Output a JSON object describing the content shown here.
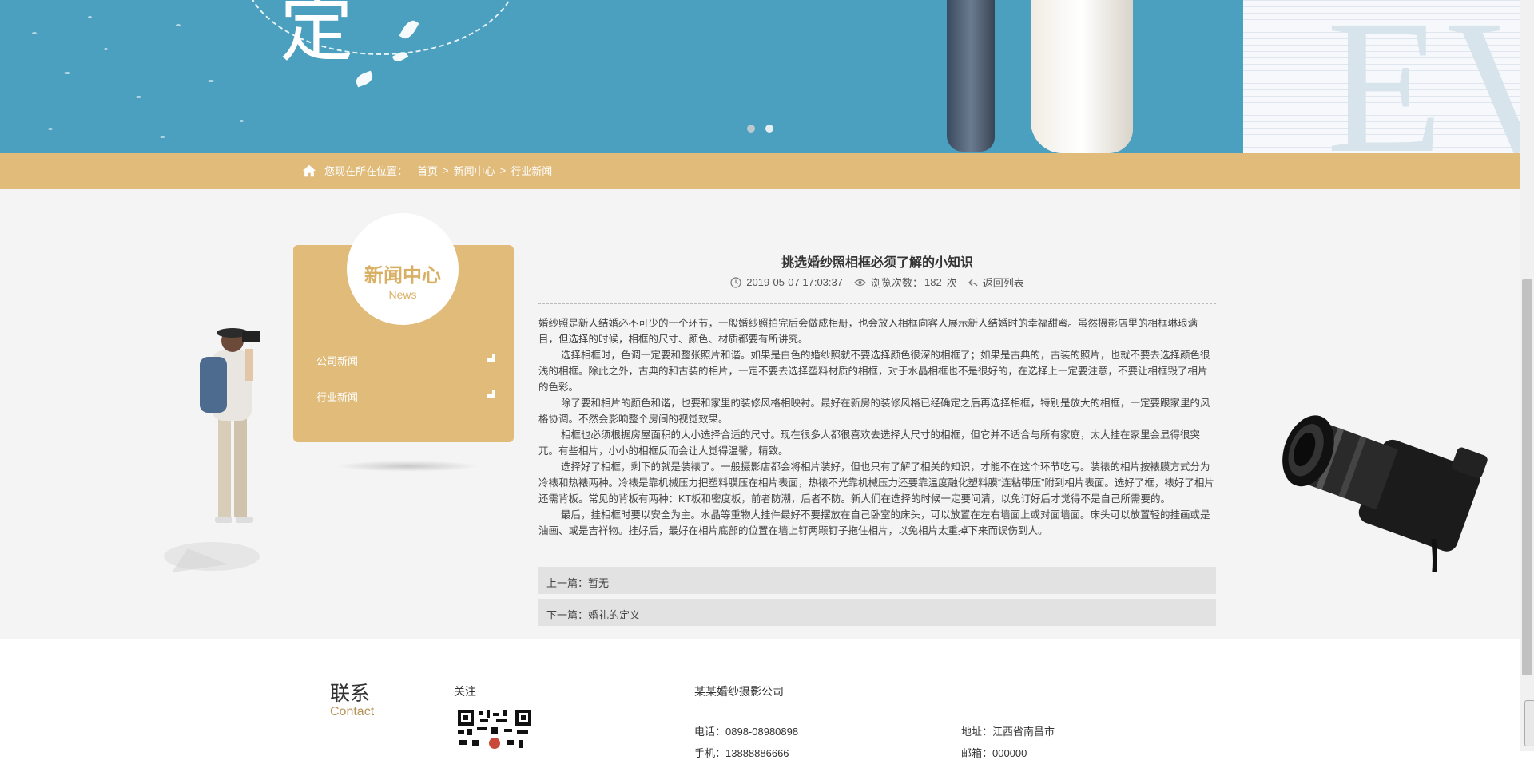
{
  "breadcrumb": {
    "prefix": "您现在所在位置：",
    "items": [
      "首页",
      "新闻中心",
      "行业新闻"
    ],
    "separator": ">"
  },
  "sidebar": {
    "title": "新闻中心",
    "subtitle": "News",
    "items": [
      {
        "label": "公司新闻"
      },
      {
        "label": "行业新闻"
      }
    ]
  },
  "article": {
    "title": "挑选婚纱照相框必须了解的小知识",
    "date": "2019-05-07 17:03:37",
    "views_label": "浏览次数：",
    "views": "182",
    "views_unit": "次",
    "back_label": "返回列表",
    "paragraphs": [
      "婚纱照是新人结婚必不可少的一个环节，一般婚纱照拍完后会做成相册，也会放入相框向客人展示新人结婚时的幸福甜蜜。虽然摄影店里的相框琳琅满目，但选择的时候，相框的尺寸、颜色、材质都要有所讲究。",
      "选择相框时，色调一定要和整张照片和谐。如果是白色的婚纱照就不要选择颜色很深的相框了；如果是古典的，古装的照片，也就不要去选择颜色很浅的相框。除此之外，古典的和古装的相片，一定不要去选择塑料材质的相框，对于水晶相框也不是很好的，在选择上一定要注意，不要让相框毁了相片的色彩。",
      "除了要和相片的颜色和谐，也要和家里的装修风格相映衬。最好在新房的装修风格已经确定之后再选择相框，特别是放大的相框，一定要跟家里的风格协调。不然会影响整个房间的视觉效果。",
      "相框也必须根据房屋面积的大小选择合适的尺寸。现在很多人都很喜欢去选择大尺寸的相框，但它并不适合与所有家庭，太大挂在家里会显得很突兀。有些相片，小小的相框反而会让人觉得温馨，精致。",
      "选择好了相框，剩下的就是装裱了。一般摄影店都会将相片装好，但也只有了解了相关的知识，才能不在这个环节吃亏。装裱的相片按裱膜方式分为冷裱和热裱两种。冷裱是靠机械压力把塑料膜压在相片表面，热裱不光靠机械压力还要靠温度融化塑料膜“连粘带压”附到相片表面。选好了框，裱好了相片还需背板。常见的背板有两种：KT板和密度板，前者防潮，后者不防。新人们在选择的时候一定要问清，以免订好后才觉得不是自己所需要的。",
      "最后，挂相框时要以安全为主。水晶等重物大挂件最好不要摆放在自己卧室的床头，可以放置在左右墙面上或对面墙面。床头可以放置轻的挂画或是油画、或是吉祥物。挂好后，最好在相片底部的位置在墙上钉两颗钉子拖住相片，以免相片太重掉下来而误伤到人。"
    ],
    "prev": "上一篇：暂无",
    "next": "下一篇：婚礼的定义"
  },
  "footer": {
    "contact_cn": "联系",
    "contact_en": "Contact",
    "follow": "关注",
    "company": "某某婚纱摄影公司",
    "phone": "电话：0898-08980898",
    "mobile": "手机：13888886666",
    "address": "地址：江西省南昌市",
    "email": "邮箱：000000"
  },
  "banner": {
    "slides_total": 2,
    "active_slide": 1
  },
  "colors": {
    "accent": "#e0bb7a",
    "banner_blue": "#4b9fbf",
    "main_bg": "#f4f4f4"
  },
  "icons": [
    "home-icon",
    "clock-icon",
    "eye-icon",
    "return-icon",
    "corner-icon",
    "qr-code-icon"
  ]
}
